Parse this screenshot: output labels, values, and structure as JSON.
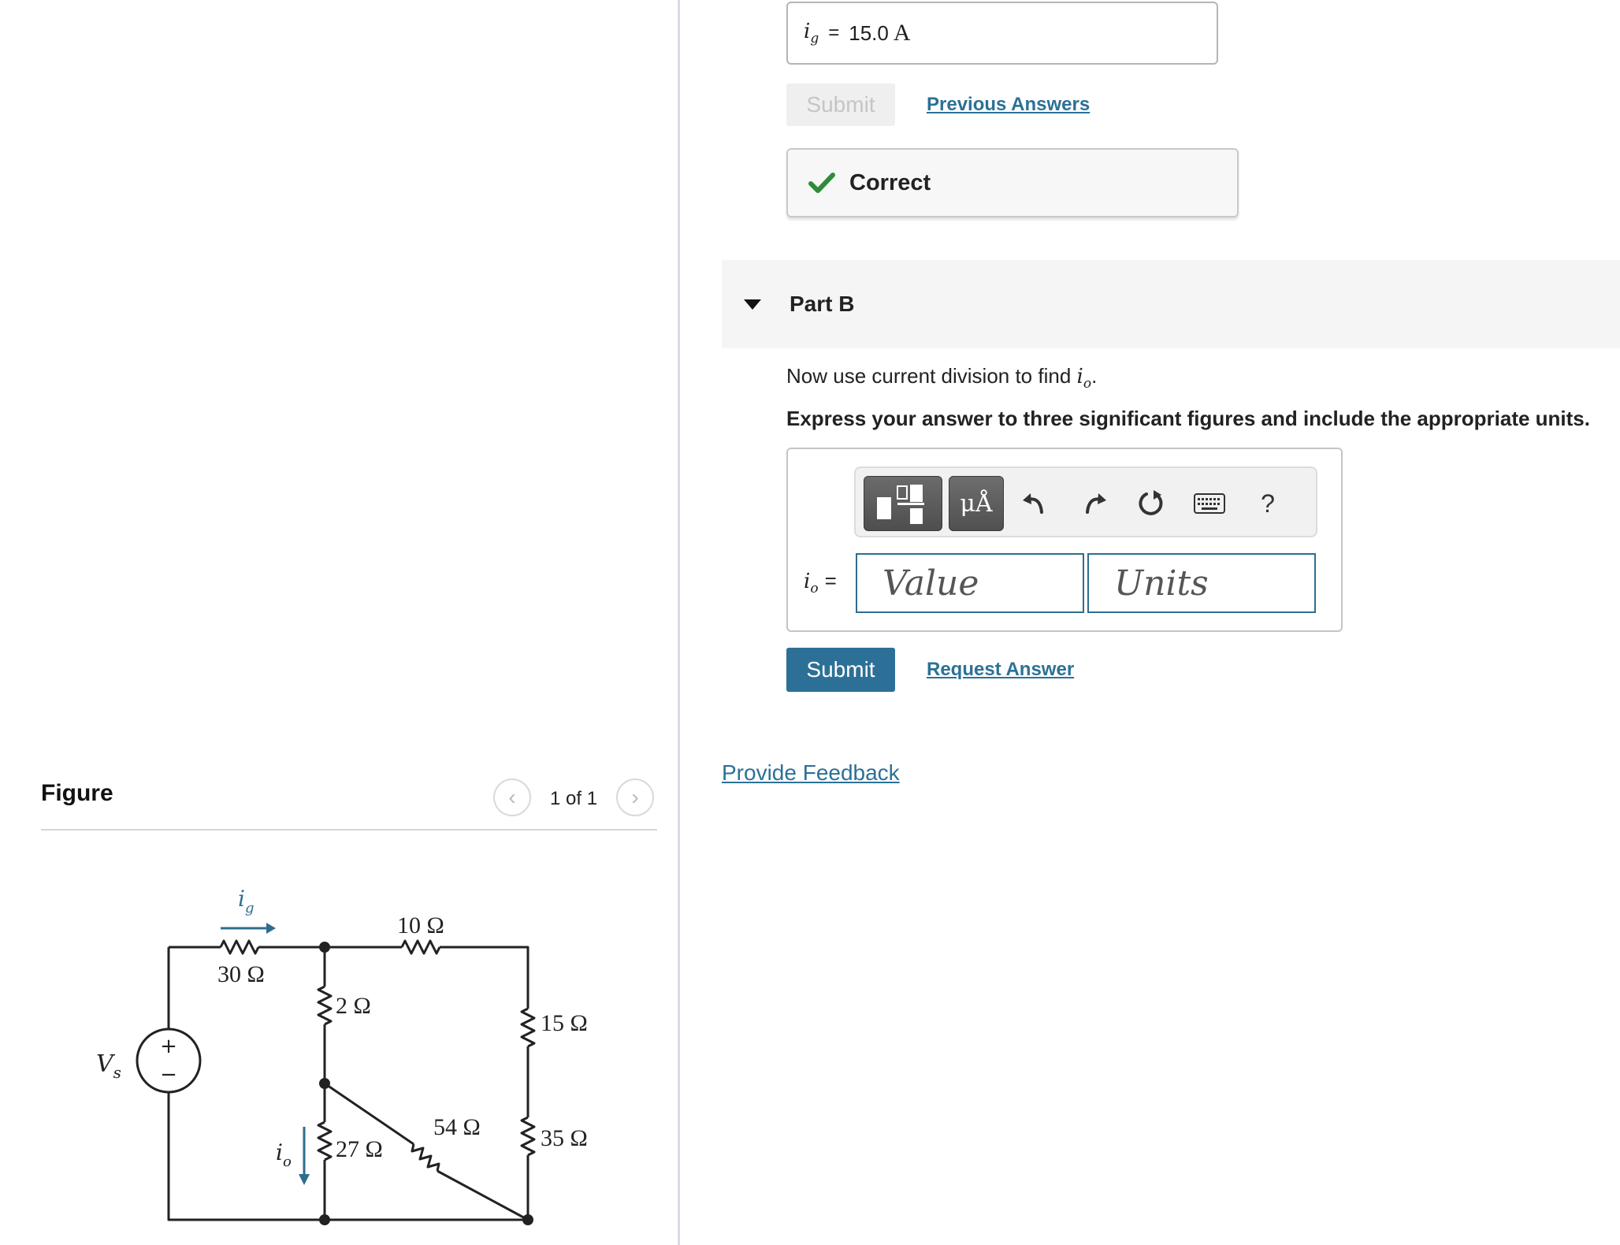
{
  "part_a": {
    "answer_var": "i",
    "answer_sub": "g",
    "equals": "=",
    "answer_value": "15.0",
    "answer_unit": "A",
    "submit_label": "Submit",
    "previous_answers_label": "Previous Answers",
    "feedback_text": "Correct"
  },
  "part_b": {
    "title": "Part B",
    "prompt_text": "Now use current division to find ",
    "prompt_var": "i",
    "prompt_sub": "o",
    "prompt_end": ".",
    "instructions": "Express your answer to three significant figures and include the appropriate units.",
    "toolbar": {
      "units_label": "μÅ",
      "help_label": "?",
      "icons": [
        "templates-icon",
        "units-icon",
        "undo-icon",
        "redo-icon",
        "reset-icon",
        "keyboard-icon",
        "help-icon"
      ]
    },
    "answer_var": "i",
    "answer_sub": "o",
    "equals": "=",
    "value_placeholder": "Value",
    "units_placeholder": "Units",
    "submit_label": "Submit",
    "request_answer_label": "Request Answer"
  },
  "provide_feedback_label": "Provide Feedback",
  "figure": {
    "title": "Figure",
    "counter": "1 of 1",
    "labels": {
      "ig": "i",
      "ig_sub": "g",
      "r30": "30 Ω",
      "r10": "10 Ω",
      "r2": "2 Ω",
      "r15": "15 Ω",
      "r54": "54 Ω",
      "r35": "35 Ω",
      "r27": "27 Ω",
      "vs": "V",
      "vs_sub": "s",
      "io": "i",
      "io_sub": "o",
      "plus": "+",
      "minus": "−"
    }
  },
  "colors": {
    "accent": "#2d7097",
    "link": "#2b7196",
    "success": "#2e8b3a",
    "arrow": "#2f6d8f"
  }
}
